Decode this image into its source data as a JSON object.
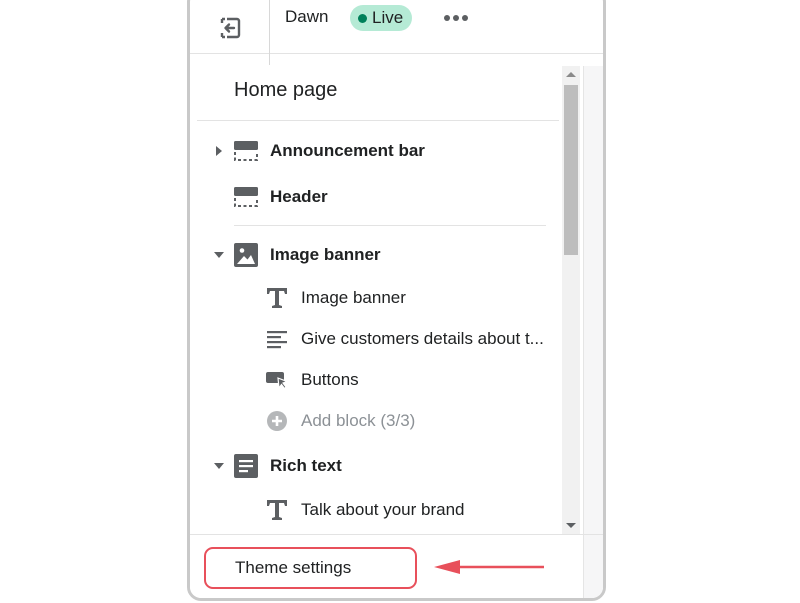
{
  "topbar": {
    "exit_icon": "exit-icon",
    "theme_name": "Dawn",
    "status_badge": "Live",
    "status_color": "#00805a",
    "badge_bg": "#b5ead5",
    "more_icon": "more-horizontal-icon"
  },
  "page": {
    "title": "Home page"
  },
  "sections": [
    {
      "label": "Announcement bar",
      "icon": "section-header-icon",
      "expanded": false,
      "has_caret": true
    },
    {
      "label": "Header",
      "icon": "section-header-icon",
      "expanded": false,
      "has_caret": false
    },
    {
      "label": "Image banner",
      "icon": "image-icon",
      "expanded": true,
      "has_caret": true,
      "blocks": [
        {
          "label": "Image banner",
          "icon": "text-icon"
        },
        {
          "label": "Give customers details about t...",
          "icon": "paragraph-icon"
        },
        {
          "label": "Buttons",
          "icon": "button-cursor-icon"
        },
        {
          "label": "Add block (3/3)",
          "icon": "add-circle-icon",
          "disabled": true
        }
      ]
    },
    {
      "label": "Rich text",
      "icon": "rich-text-icon",
      "expanded": true,
      "has_caret": true,
      "blocks": [
        {
          "label": "Talk about your brand",
          "icon": "text-icon"
        }
      ]
    }
  ],
  "footer": {
    "theme_settings_label": "Theme settings",
    "highlight_color": "#e8505b"
  }
}
